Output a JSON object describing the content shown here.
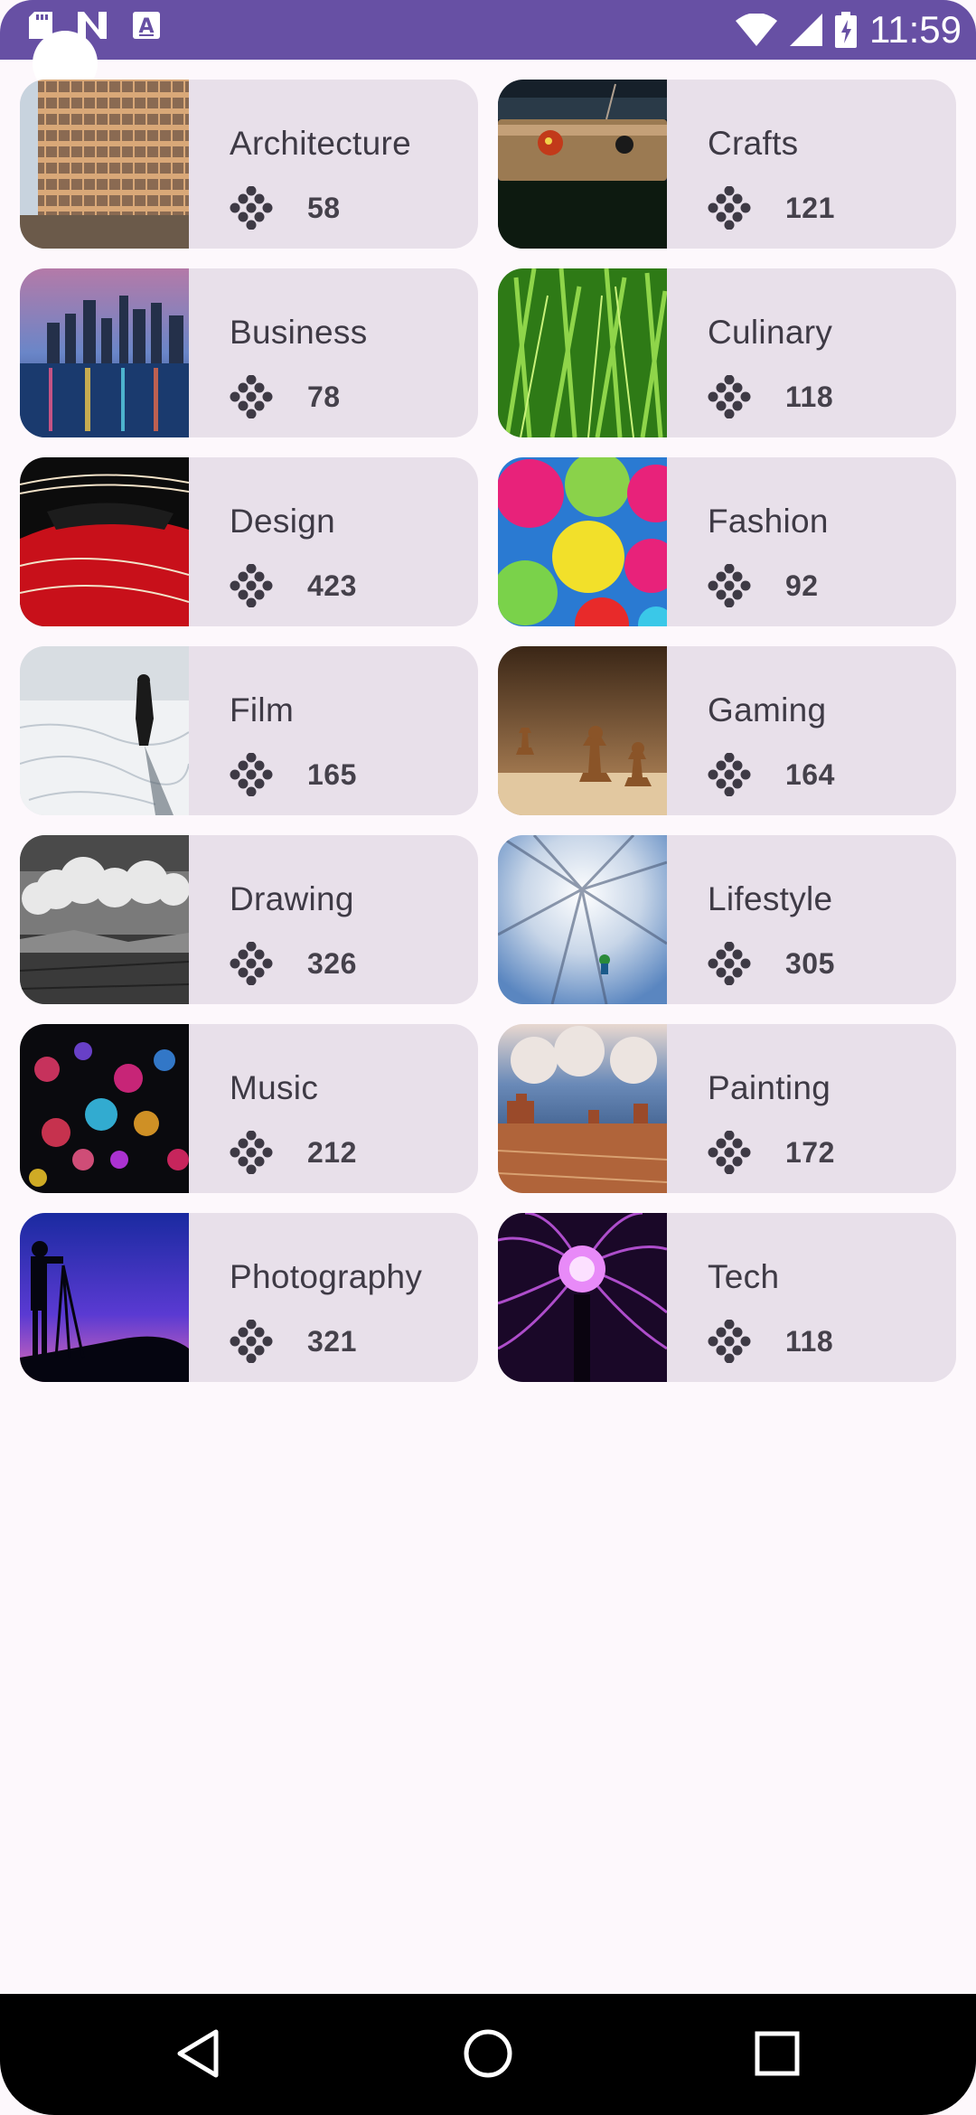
{
  "status_bar": {
    "time": "11:59"
  },
  "categories": [
    {
      "label": "Architecture",
      "count": "58"
    },
    {
      "label": "Crafts",
      "count": "121"
    },
    {
      "label": "Business",
      "count": "78"
    },
    {
      "label": "Culinary",
      "count": "118"
    },
    {
      "label": "Design",
      "count": "423"
    },
    {
      "label": "Fashion",
      "count": "92"
    },
    {
      "label": "Film",
      "count": "165"
    },
    {
      "label": "Gaming",
      "count": "164"
    },
    {
      "label": "Drawing",
      "count": "326"
    },
    {
      "label": "Lifestyle",
      "count": "305"
    },
    {
      "label": "Music",
      "count": "212"
    },
    {
      "label": "Painting",
      "count": "172"
    },
    {
      "label": "Photography",
      "count": "321"
    },
    {
      "label": "Tech",
      "count": "118"
    }
  ],
  "colors": {
    "accent": "#6750a4",
    "card": "#e8e0ea",
    "background": "#fdf8fc"
  },
  "icons": {
    "count_icon": "dotted-grid-icon",
    "nav": [
      "back-triangle-icon",
      "home-circle-icon",
      "recents-square-icon"
    ]
  }
}
